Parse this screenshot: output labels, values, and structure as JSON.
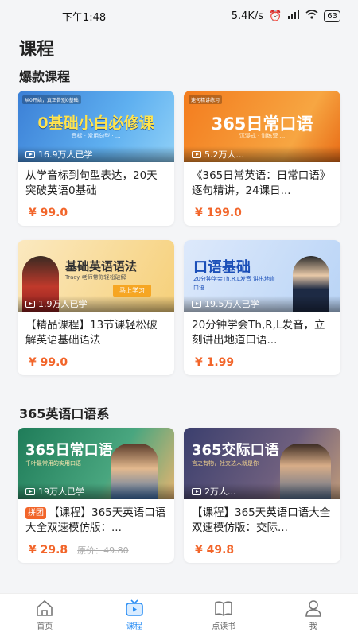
{
  "status_bar": {
    "time": "下午1:48",
    "speed": "5.4K/s",
    "battery": "63"
  },
  "page_title": "课程",
  "sections": [
    {
      "title": "爆款课程",
      "cards": [
        {
          "tag": "从0开始，真正告别0基础",
          "banner": "0基础小白必修课",
          "banner_sub": "音标 · 常用句型 · ...",
          "learners": "16.9万人已学",
          "title": "从学音标到句型表达，20天突破英语0基础",
          "price": "¥ 99.0"
        },
        {
          "tag": "速句精讲练习",
          "banner": "365日常口语",
          "banner_sub": "沉浸式 · 训练营 ...",
          "learners": "5.2万人...",
          "title": "《365日常英语：日常口语》逐句精讲，24课日...",
          "price": "¥ 199.0"
        },
        {
          "tag": "",
          "banner": "基础英语语法",
          "banner_sub": "Tracy 老师带你轻松破解",
          "cta": "马上学习",
          "learners": "1.9万人已学",
          "title": "【精品课程】13节课轻松破解英语基础语法",
          "price": "¥ 99.0"
        },
        {
          "tag": "",
          "banner": "口语基础",
          "banner_sub": "20分钟学会Th,R,L发音 讲出地道口语",
          "learners": "19.5万人已学",
          "title": "20分钟学会Th,R,L发音，立刻讲出地道口语...",
          "price": "¥ 1.99"
        }
      ]
    },
    {
      "title": "365英语口语系",
      "cards": [
        {
          "tag": "",
          "banner": "365日常口语",
          "banner_sub": "千叶最常用的实用口语",
          "learners": "19万人已学",
          "badge": "拼团",
          "title": "【课程】365天英语口语大全双速模仿版：...",
          "price": "¥ 29.8",
          "original_price": "原价：49.80"
        },
        {
          "tag": "",
          "banner": "365交际口语",
          "banner_sub": "言之有物，社交达人就是你",
          "learners": "2万人...",
          "title": "【课程】365天英语口语大全双速模仿版：交际...",
          "price": "¥ 49.8"
        }
      ]
    }
  ],
  "tabbar": [
    {
      "label": "首页",
      "icon": "home-icon",
      "active": false
    },
    {
      "label": "课程",
      "icon": "tv-icon",
      "active": true
    },
    {
      "label": "点读书",
      "icon": "book-icon",
      "active": false
    },
    {
      "label": "我",
      "icon": "user-icon",
      "active": false
    }
  ],
  "colors": {
    "accent": "#2a8ef4",
    "price": "#f2652a",
    "background": "#f4f5f7"
  }
}
